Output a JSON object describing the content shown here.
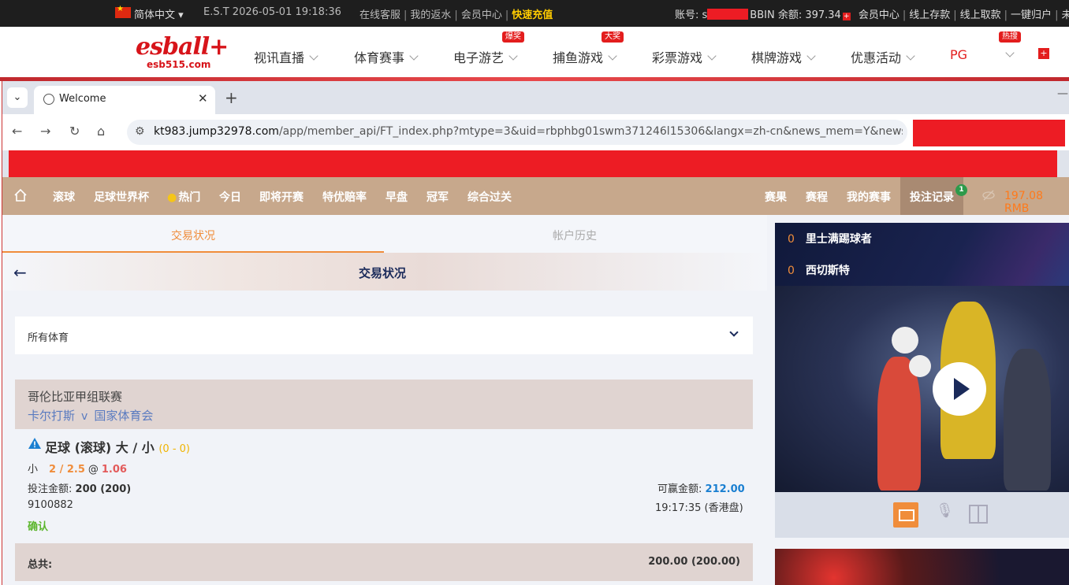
{
  "topbar": {
    "language": "简体中文",
    "time": "E.S.T 2026-05-01 19:18:36",
    "links": [
      "在线客服",
      "我的返水",
      "会员中心"
    ],
    "highlight_link": "快速充值",
    "account_label": "账号: s",
    "bbin_label": "BBIN 余额: 397.34",
    "account_links": [
      "会员中心",
      "线上存款",
      "线上取款",
      "一键归户",
      "未读"
    ]
  },
  "site": {
    "logo": "esball+",
    "logo_sub": "esb515.com",
    "nav": [
      {
        "label": "视讯直播",
        "badge": ""
      },
      {
        "label": "体育赛事",
        "badge": ""
      },
      {
        "label": "电子游艺",
        "badge": "爆奖"
      },
      {
        "label": "捕鱼游戏",
        "badge": "大奖"
      },
      {
        "label": "彩票游戏",
        "badge": ""
      },
      {
        "label": "棋牌游戏",
        "badge": ""
      },
      {
        "label": "优惠活动",
        "badge": ""
      },
      {
        "label": "PG",
        "badge": "热搜"
      }
    ]
  },
  "browser": {
    "tab_title": "Welcome",
    "url_host": "kt983.jump32978.com",
    "url_path": "/app/member_api/FT_index.php?mtype=3&uid=rbphbg01swm371246l15306&langx=zh-cn&news_mem=Y&news_ap..."
  },
  "sbnav": {
    "left_items": [
      "滚球",
      "足球世界杯",
      "热门",
      "今日",
      "即将开赛",
      "特优赔率",
      "早盘",
      "冠军",
      "综合过关"
    ],
    "right_items": [
      "赛果",
      "赛程",
      "我的赛事",
      "投注记录"
    ],
    "bet_record_count": "1",
    "balance": "197.08",
    "currency": "RMB"
  },
  "tabs": {
    "active": "交易状况",
    "inactive": "帐户历史"
  },
  "header_title": "交易状况",
  "filter_label": "所有体育",
  "bet": {
    "league": "哥伦比亚甲组联赛",
    "home": "卡尔打斯",
    "vs": "v",
    "away": "国家体育会",
    "market": "足球 (滚球) 大 / 小",
    "score": "(0 - 0)",
    "selection": "小",
    "line": "2 / 2.5",
    "at": "@",
    "odds": "1.06",
    "stake_label": "投注金额:",
    "stake": "200 (200)",
    "win_label": "可赢金额:",
    "win": "212.00",
    "ticket_id": "9100882",
    "time": "19:17:35 (香港盘)",
    "status": "确认"
  },
  "total": {
    "label": "总共:",
    "value": "200.00 (200.00)"
  },
  "live": {
    "rows": [
      {
        "score": "0",
        "team": "里士满踢球者"
      },
      {
        "score": "0",
        "team": "西切斯特"
      }
    ]
  },
  "colors": {
    "accent": "#f08d3b",
    "brand": "#d7141a",
    "nav": "#c7a88c"
  }
}
